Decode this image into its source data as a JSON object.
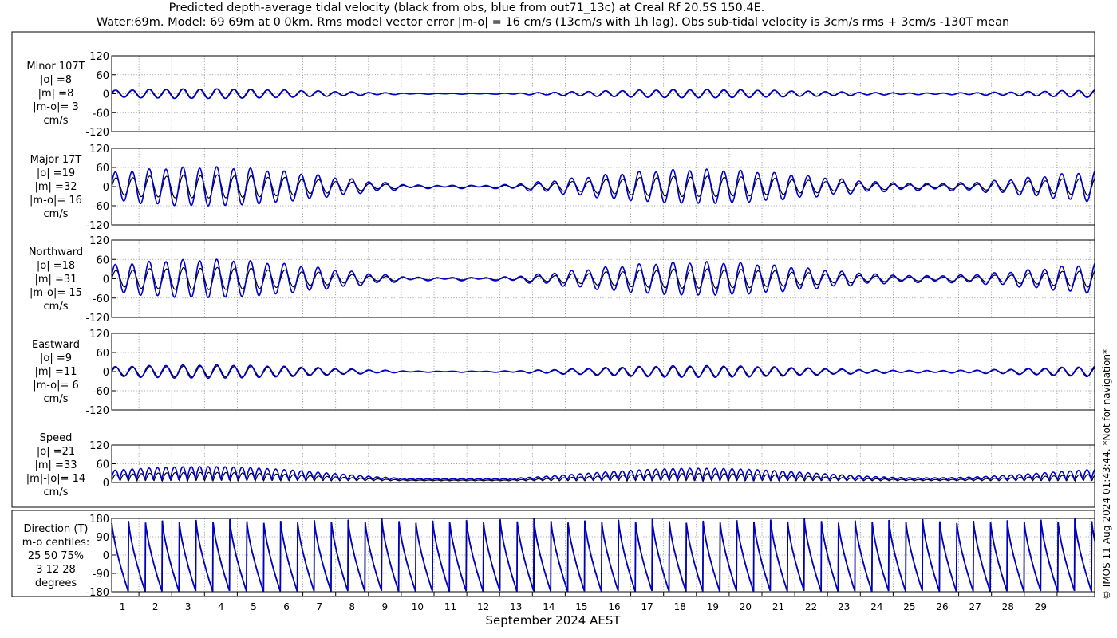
{
  "title": {
    "line1": "Predicted depth-average tidal velocity (black from obs, blue from out71_13c) at Creal Rf 20.5S 150.4E.",
    "line2": "Water:69m. Model: 69 69m at 0 0km. Rms model vector error |m-o| = 16 cm/s (13cm/s with 1h lag). Obs sub-tidal velocity is 3cm/s rms + 3cm/s -130T mean"
  },
  "watermark": "© IMOS 11-Aug-2024 01:43:44. *Not for navigation*",
  "xaxis": {
    "label": "September 2024 AEST",
    "ticks": [
      "1",
      "2",
      "3",
      "4",
      "5",
      "6",
      "7",
      "8",
      "9",
      "10",
      "11",
      "12",
      "13",
      "14",
      "15",
      "16",
      "17",
      "18",
      "19",
      "20",
      "21",
      "22",
      "23",
      "24",
      "25",
      "26",
      "27",
      "28",
      "29"
    ]
  },
  "colors": {
    "obs": "#000000",
    "model": "#0000cc",
    "grid": "#888888"
  },
  "panels": [
    {
      "key": "minor",
      "label": [
        "Minor 107T",
        "|o| =8",
        "|m| =8",
        "|m-o|= 3",
        "cm/s"
      ],
      "ticks": [
        "120",
        "60",
        "0",
        "-60",
        "-120"
      ],
      "ylim": [
        -120,
        120
      ],
      "amp_obs": 8,
      "amp_model": 8,
      "mode": "vel"
    },
    {
      "key": "major",
      "label": [
        "Major 17T",
        "|o| =19",
        "|m| =32",
        "|m-o|= 16",
        "cm/s"
      ],
      "ticks": [
        "120",
        "60",
        "0",
        "-60",
        "-120"
      ],
      "ylim": [
        -120,
        120
      ],
      "amp_obs": 19,
      "amp_model": 32,
      "mode": "vel"
    },
    {
      "key": "north",
      "label": [
        "Northward",
        "|o| =18",
        "|m| =31",
        "|m-o|= 15",
        "cm/s"
      ],
      "ticks": [
        "120",
        "60",
        "0",
        "-60",
        "-120"
      ],
      "ylim": [
        -120,
        120
      ],
      "amp_obs": 18,
      "amp_model": 31,
      "mode": "vel"
    },
    {
      "key": "east",
      "label": [
        "Eastward",
        "|o| =9",
        "|m| =11",
        "|m-o|= 6",
        "cm/s"
      ],
      "ticks": [
        "120",
        "60",
        "0",
        "-60",
        "-120"
      ],
      "ylim": [
        -120,
        120
      ],
      "amp_obs": 9,
      "amp_model": 11,
      "mode": "vel"
    },
    {
      "key": "speed",
      "label": [
        "Speed",
        "|o| =21",
        "|m| =33",
        "|m|-|o|= 14",
        "cm/s"
      ],
      "ticks": [
        "120",
        "60",
        "0"
      ],
      "ylim": [
        0,
        120
      ],
      "amp_obs": 21,
      "amp_model": 33,
      "mode": "speed"
    },
    {
      "key": "dir",
      "label": [
        "Direction (T)",
        "m-o centiles:",
        "25  50  75%",
        "3  12  28",
        "degrees"
      ],
      "ticks": [
        "180",
        "90",
        "0",
        "-90",
        "-180"
      ],
      "ylim": [
        -180,
        180
      ],
      "mode": "dir"
    }
  ]
}
